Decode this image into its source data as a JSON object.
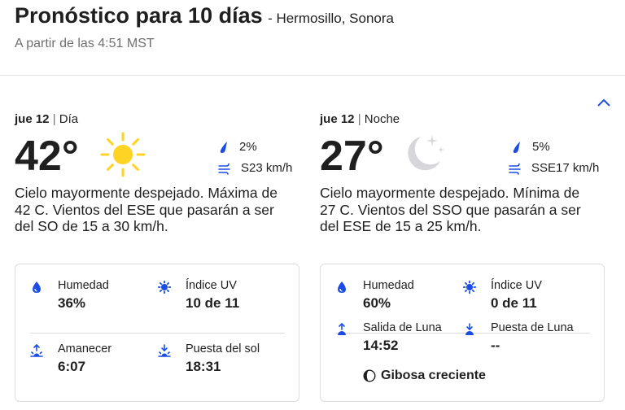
{
  "header": {
    "title": "Pronóstico para 10 días",
    "location": "- Hermosillo, Sonora",
    "subtitle": "A partir de las 4:51 MST"
  },
  "colors": {
    "accent": "#1b4de4",
    "sun": "#ffd323",
    "moon": "#d6d6db",
    "text": "#1f1f1f"
  },
  "day": {
    "date": "jue 12",
    "part": "Día",
    "temp": "42°",
    "icon": "sun-icon",
    "precip": "2%",
    "wind": "S23 km/h",
    "narrative": "Cielo mayormente despejado. Máxima de 42 C. Vientos del ESE que pasarán a ser del SO de 15 a 30 km/h.",
    "details": {
      "humidity_label": "Humedad",
      "humidity": "36%",
      "uv_label": "Índice UV",
      "uv": "10 de 11",
      "sunrise_label": "Amanecer",
      "sunrise": "6:07",
      "sunset_label": "Puesta del sol",
      "sunset": "18:31"
    }
  },
  "night": {
    "date": "jue 12",
    "part": "Noche",
    "temp": "27°",
    "icon": "moon-icon",
    "precip": "5%",
    "wind": "SSE17 km/h",
    "narrative": "Cielo mayormente despejado. Mínima de 27 C. Vientos del SSO que pasarán a ser del ESE de 15 a 25 km/h.",
    "details": {
      "humidity_label": "Humedad",
      "humidity": "60%",
      "uv_label": "Índice UV",
      "uv": "0 de 11",
      "moonrise_label": "Salida de Luna",
      "moonrise": "14:52",
      "moonset_label": "Puesta de Luna",
      "moonset": "--",
      "moon_phase": "Gibosa creciente"
    }
  },
  "separator": "|"
}
